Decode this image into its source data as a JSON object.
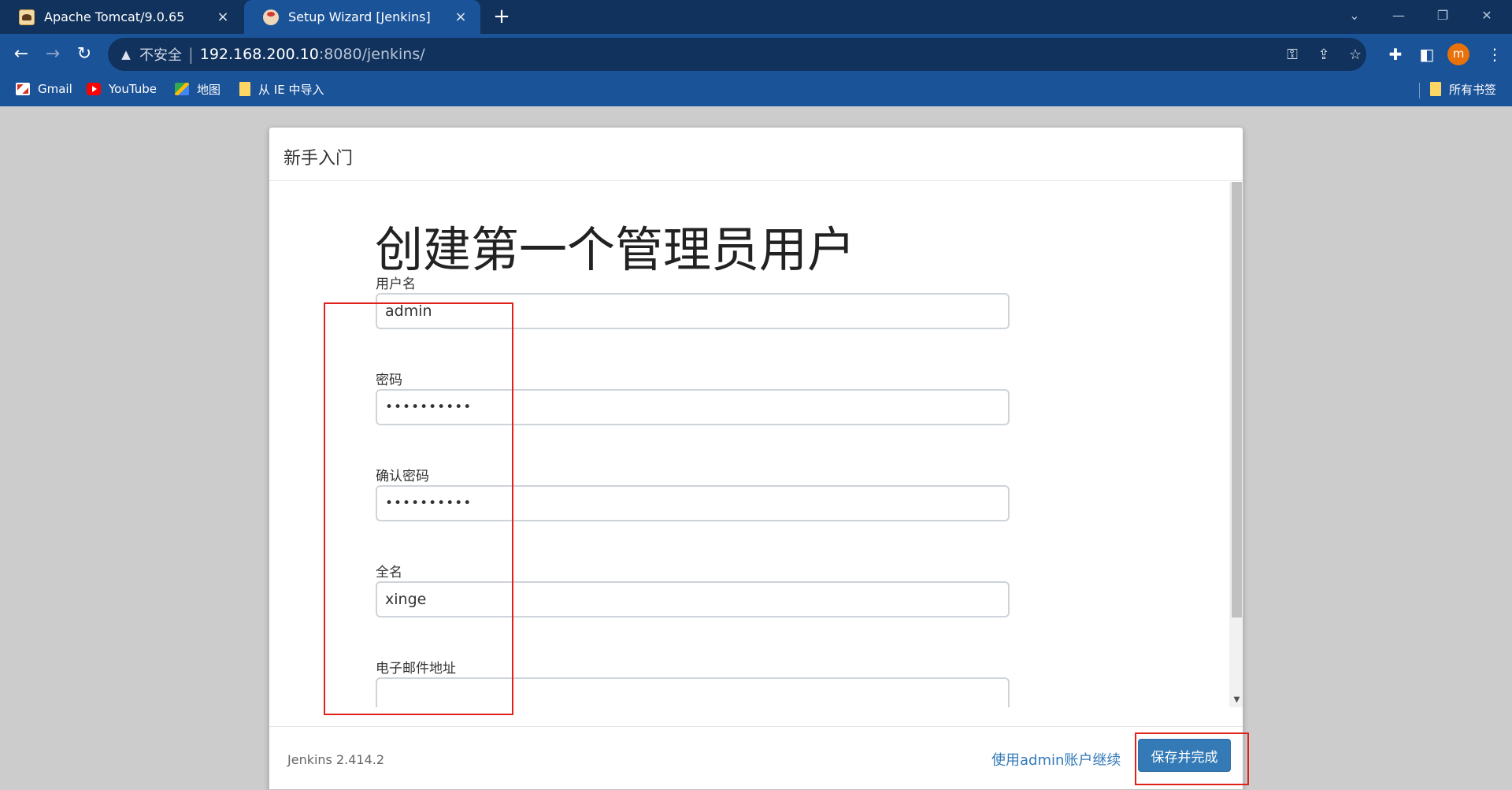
{
  "browser": {
    "tabs": [
      {
        "title": "Apache Tomcat/9.0.65",
        "active": false
      },
      {
        "title": "Setup Wizard [Jenkins]",
        "active": true
      }
    ],
    "new_tab": "+",
    "close_glyph": "×",
    "address": {
      "security_label": "不安全",
      "separator": "|",
      "host": "192.168.200.10",
      "rest": ":8080/jenkins/"
    },
    "profile_initial": "m",
    "bookmarks": [
      "Gmail",
      "YouTube",
      "地图",
      "从 IE 中导入"
    ],
    "all_bookmarks": "所有书签"
  },
  "wizard": {
    "header_title": "新手入门",
    "heading": "创建第一个管理员用户",
    "fields": [
      {
        "label": "用户名",
        "value": "admin",
        "type": "text"
      },
      {
        "label": "密码",
        "value": "••••••••••",
        "type": "password"
      },
      {
        "label": "确认密码",
        "value": "••••••••••",
        "type": "password"
      },
      {
        "label": "全名",
        "value": "xinge",
        "type": "text"
      },
      {
        "label": "电子邮件地址",
        "value": "",
        "type": "text"
      }
    ],
    "footer": {
      "version": "Jenkins 2.414.2",
      "continue_link": "使用admin账户继续",
      "save_button": "保存并完成"
    }
  },
  "colors": {
    "tab_bar": "#10325d",
    "toolbar": "#1b5399",
    "primary_button": "#337ab7",
    "annotation_red": "#e0201b"
  }
}
